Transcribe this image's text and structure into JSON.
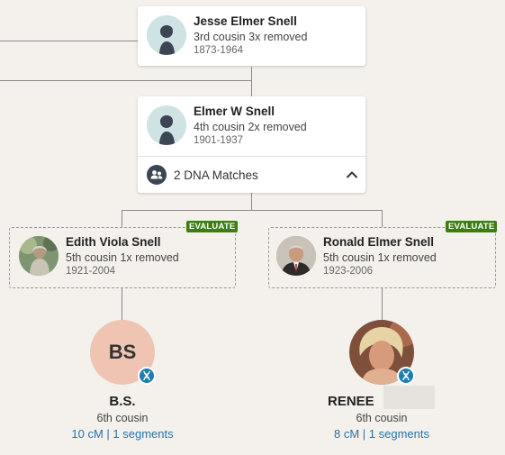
{
  "ancestors": [
    {
      "name": "Jesse Elmer Snell",
      "relationship": "3rd cousin 3x removed",
      "dates": "1873-1964"
    },
    {
      "name": "Elmer W Snell",
      "relationship": "4th cousin 2x removed",
      "dates": "1901-1937",
      "dna_matches_label": "2 DNA Matches"
    }
  ],
  "children": [
    {
      "badge": "EVALUATE",
      "name": "Edith Viola Snell",
      "relationship": "5th cousin 1x removed",
      "dates": "1921-2004"
    },
    {
      "badge": "EVALUATE",
      "name": "Ronald Elmer Snell",
      "relationship": "5th cousin 1x removed",
      "dates": "1923-2006"
    }
  ],
  "matches": [
    {
      "initials": "BS",
      "name": "B.S.",
      "relationship": "6th cousin",
      "shared_dna": "10 cM | 1 segments"
    },
    {
      "name": "RENEE",
      "relationship": "6th cousin",
      "shared_dna": "8 cM | 1 segments"
    }
  ],
  "colors": {
    "background": "#f4f1ec",
    "evaluate_badge": "#3a7f0f",
    "link": "#2873a6",
    "dna_badge": "#1b7fb3",
    "initials_avatar": "#efc4b3"
  }
}
